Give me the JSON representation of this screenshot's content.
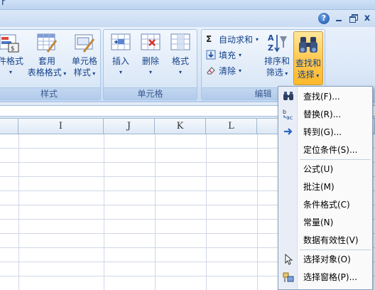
{
  "window": {
    "title_fragment": "r",
    "help": "?",
    "minimize": "–",
    "close": "x"
  },
  "ribbon": {
    "groups": {
      "styles": {
        "label": "样式",
        "buttons": [
          {
            "line1": "件格式",
            "line2": "·"
          },
          {
            "line1": "套用",
            "line2": "表格格式"
          },
          {
            "line1": "单元格",
            "line2": "样式"
          }
        ]
      },
      "cells": {
        "label": "单元格",
        "buttons": [
          {
            "line1": "插入",
            "line2": "·"
          },
          {
            "line1": "删除",
            "line2": "·"
          },
          {
            "line1": "格式",
            "line2": "·"
          }
        ]
      },
      "editing": {
        "label": "编辑",
        "autosum": "自动求和",
        "fill": "填充",
        "clear": "清除",
        "sort_line1": "排序和",
        "sort_line2": "筛选",
        "find_line1": "查找和",
        "find_line2": "选择"
      }
    }
  },
  "grid": {
    "columns": [
      "I",
      "J",
      "K",
      "L"
    ]
  },
  "menu": {
    "items": [
      {
        "label": "查找(F)...",
        "icon": "binoculars-icon"
      },
      {
        "label": "替换(R)...",
        "icon": "replace-icon"
      },
      {
        "label": "转到(G)...",
        "icon": "goto-arrow-icon"
      },
      {
        "label": "定位条件(S)...",
        "icon": ""
      },
      {
        "label": "公式(U)",
        "icon": ""
      },
      {
        "label": "批注(M)",
        "icon": ""
      },
      {
        "label": "条件格式(C)",
        "icon": ""
      },
      {
        "label": "常量(N)",
        "icon": ""
      },
      {
        "label": "数据有效性(V)",
        "icon": ""
      },
      {
        "label": "选择对象(O)",
        "icon": "select-pointer-icon"
      },
      {
        "label": "选择窗格(P)...",
        "icon": "selection-pane-icon"
      }
    ]
  },
  "colors": {
    "ribbon_text": "#15428b",
    "find_highlight": "#ffc74d",
    "grid_line": "#d0d7e5"
  }
}
